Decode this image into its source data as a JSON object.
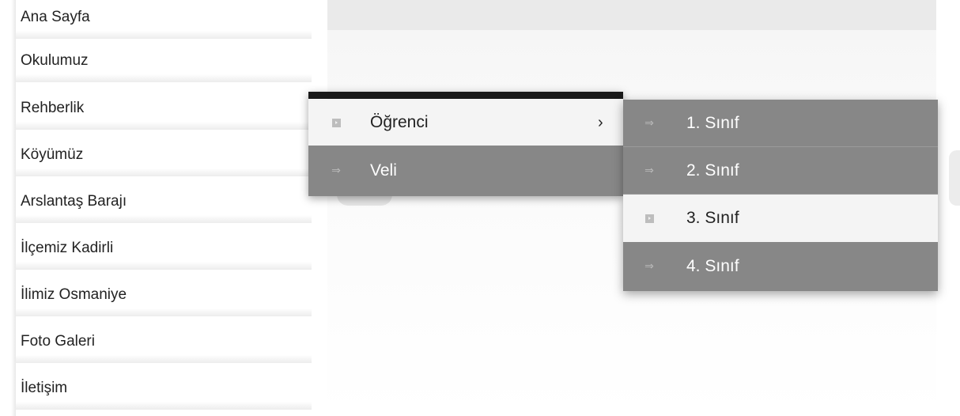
{
  "sidebar": {
    "items": [
      {
        "label": "Ana Sayfa"
      },
      {
        "label": "Okulumuz"
      },
      {
        "label": "Rehberlik"
      },
      {
        "label": "Köyümüz"
      },
      {
        "label": "Arslantaş Barajı"
      },
      {
        "label": "İlçemiz Kadirli"
      },
      {
        "label": "İlimiz Osmaniye"
      },
      {
        "label": "Foto Galeri"
      },
      {
        "label": "İletişim"
      }
    ]
  },
  "dropdown": {
    "items": [
      {
        "label": "Öğrenci",
        "icon": "square-arrow-icon",
        "chevron": "›",
        "state": "hovered"
      },
      {
        "label": "Veli",
        "icon": "arrow-right-icon",
        "state": "normal"
      }
    ]
  },
  "submenu": {
    "items": [
      {
        "label": "1. Sınıf",
        "icon": "arrow-right-icon",
        "state": "normal"
      },
      {
        "label": "2. Sınıf",
        "icon": "arrow-right-icon",
        "state": "normal"
      },
      {
        "label": "3. Sınıf",
        "icon": "square-arrow-icon",
        "state": "hovered"
      },
      {
        "label": "4. Sınıf",
        "icon": "arrow-right-icon",
        "state": "normal"
      }
    ]
  },
  "colors": {
    "menu_bg": "#878787",
    "menu_active_bg": "#f4f4f4",
    "menu_topbar": "#1a1a1a",
    "menu_text": "#ffffff",
    "active_text": "#222222",
    "sidebar_text": "#222222"
  }
}
